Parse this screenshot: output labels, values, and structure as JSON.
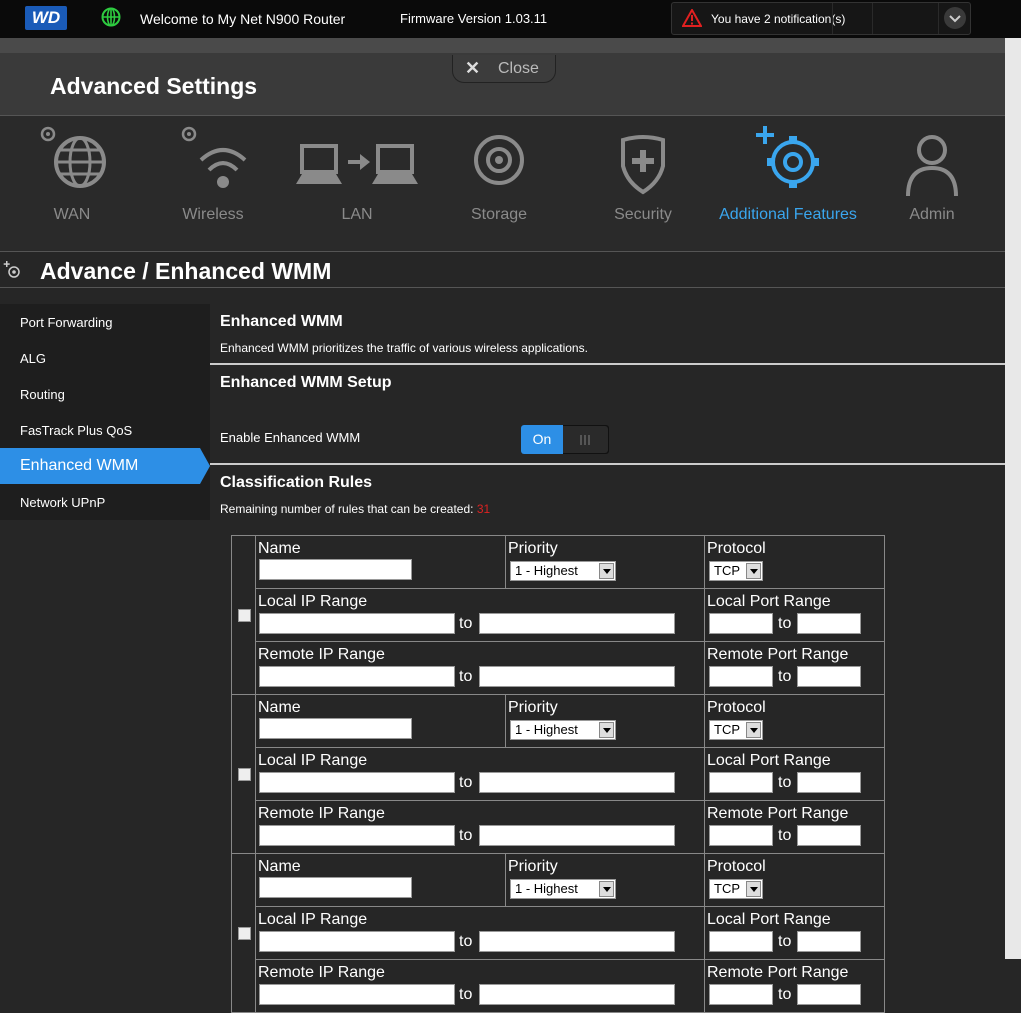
{
  "header": {
    "logo_text": "WD",
    "welcome": "Welcome to My Net N900 Router",
    "firmware": "Firmware Version 1.03.11",
    "notification": "You have 2 notification(s)"
  },
  "settings": {
    "title": "Advanced Settings",
    "close_label": "Close"
  },
  "nav": {
    "items": [
      {
        "label": "WAN",
        "icon": "globe-gear-icon"
      },
      {
        "label": "Wireless",
        "icon": "wifi-gear-icon"
      },
      {
        "label": "LAN",
        "icon": "lan-icon"
      },
      {
        "label": "Storage",
        "icon": "storage-icon"
      },
      {
        "label": "Security",
        "icon": "shield-icon"
      },
      {
        "label": "Additional Features",
        "icon": "gear-plus-icon"
      },
      {
        "label": "Admin",
        "icon": "user-icon"
      }
    ],
    "active": "Additional Features"
  },
  "page": {
    "title": "Advance / Enhanced WMM"
  },
  "sidebar": {
    "items": [
      {
        "label": "Port Forwarding"
      },
      {
        "label": "ALG"
      },
      {
        "label": "Routing"
      },
      {
        "label": "FasTrack Plus QoS"
      },
      {
        "label": "Enhanced WMM"
      },
      {
        "label": "Network UPnP"
      }
    ],
    "active": "Enhanced WMM"
  },
  "content": {
    "section_title": "Enhanced WMM",
    "section_desc": "Enhanced WMM prioritizes the traffic of various wireless applications.",
    "setup_title": "Enhanced WMM Setup",
    "enable_label": "Enable Enhanced WMM",
    "toggle_state": "On",
    "rules_title": "Classification Rules",
    "remaining_text": "Remaining number of rules that can be created:",
    "remaining_count": "31"
  },
  "rules_table": {
    "labels": {
      "name": "Name",
      "priority": "Priority",
      "protocol": "Protocol",
      "local_ip": "Local IP Range",
      "local_port": "Local Port Range",
      "remote_ip": "Remote IP Range",
      "remote_port": "Remote Port Range",
      "to": "to"
    },
    "rows": [
      {
        "priority": "1 - Highest",
        "protocol": "TCP"
      },
      {
        "priority": "1 - Highest",
        "protocol": "TCP"
      },
      {
        "priority": "1 - Highest",
        "protocol": "TCP"
      }
    ]
  }
}
